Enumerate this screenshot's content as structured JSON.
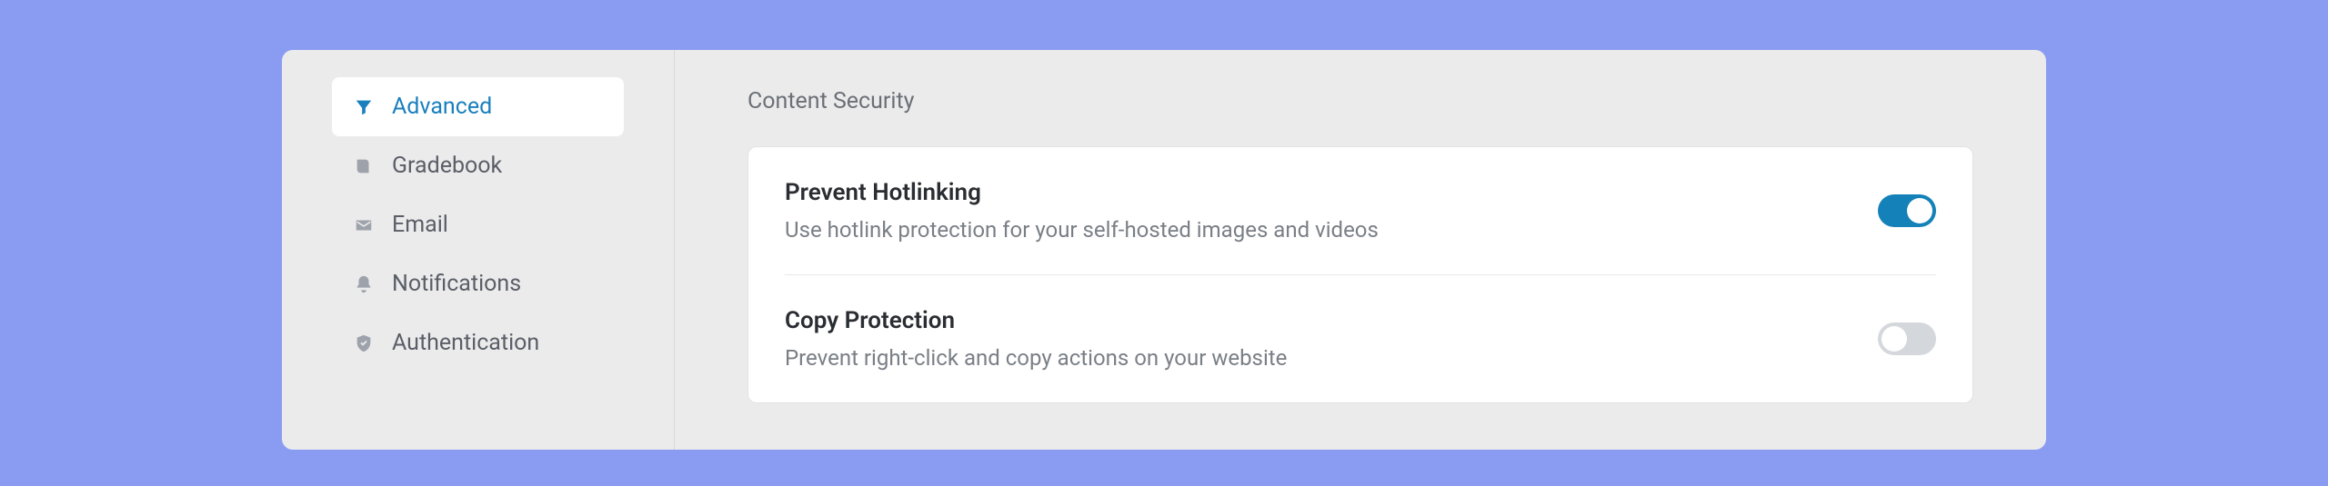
{
  "sidebar": {
    "items": [
      {
        "label": "Advanced",
        "icon": "filter-icon",
        "active": true
      },
      {
        "label": "Gradebook",
        "icon": "gradebook-icon",
        "active": false
      },
      {
        "label": "Email",
        "icon": "email-icon",
        "active": false
      },
      {
        "label": "Notifications",
        "icon": "bell-icon",
        "active": false
      },
      {
        "label": "Authentication",
        "icon": "shield-icon",
        "active": false
      }
    ]
  },
  "main": {
    "section_title": "Content Security",
    "settings": [
      {
        "name": "Prevent Hotlinking",
        "description": "Use hotlink protection for your self-hosted images and videos",
        "enabled": true
      },
      {
        "name": "Copy Protection",
        "description": "Prevent right-click and copy actions on your website",
        "enabled": false
      }
    ]
  }
}
